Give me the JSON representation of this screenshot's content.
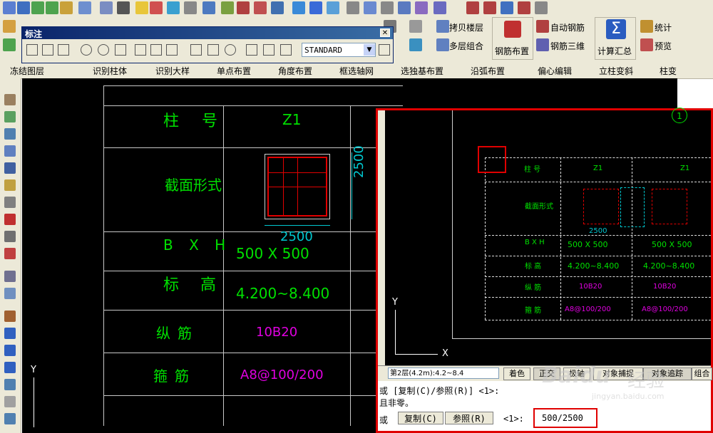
{
  "dialog": {
    "title": "标注",
    "style_value": "STANDARD"
  },
  "toolbar": {
    "copy_floor": "拷贝楼层",
    "multi_combine": "多层组合",
    "rebar_layout": "钢筋布置",
    "auto_rebar": "自动钢筋",
    "rebar_3d": "钢筋三维",
    "calc_summary": "计算汇总",
    "stats": "统计",
    "preview": "预览",
    "row3": [
      "冻结图层",
      "识别柱体",
      "识别大样",
      "单点布置",
      "角度布置",
      "框选轴网",
      "选独基布置",
      "沿弧布置",
      "偏心编辑",
      "立柱变斜",
      "柱变"
    ]
  },
  "table": {
    "col_header": "柱号",
    "col_id": "Z1",
    "row_section": "截面形式",
    "row_bxh": "B X H",
    "bxh_value": "500 X 500",
    "row_elev": "标高",
    "elev_value": "4.200~8.400",
    "row_long": "纵筋",
    "long_value": "10B20",
    "row_stirrup": "箍筋",
    "stirrup_value": "A8@100/200",
    "dim_horizontal": "2500",
    "dim_vertical": "2500",
    "axis_y": "Y"
  },
  "inset": {
    "circle_label": "1",
    "col_header": "柱 号",
    "col1": "Z1",
    "col2": "Z1",
    "row_section": "截面形式",
    "row_bxh": "B X H",
    "bxh1": "500 X 500",
    "bxh2": "500 X 500",
    "row_elev": "标 高",
    "elev1": "4.200~8.400",
    "elev2": "4.200~8.400",
    "row_long": "纵 筋",
    "long1": "10B20",
    "long2": "10B20",
    "row_stirrup": "箍 筋",
    "stirrup1": "A8@100/200",
    "stirrup2": "A8@100/200",
    "dim": "2500",
    "axis_x": "X",
    "axis_y": "Y",
    "floor_select": "第2层(4.2m):4.2~8.4",
    "status_buttons": [
      "着色",
      "正交",
      "极轴",
      "对象捕捉",
      "对象追踪",
      "组合"
    ],
    "cmd_line1": "或 [复制(C)/参照(R)] <1>:",
    "cmd_line2": "且非零。",
    "cmd_prefix": "或",
    "cmd_copy": "复制(C)",
    "cmd_ref": "参照(R)",
    "cmd_default": "<1>:",
    "cmd_input": "500/2500"
  },
  "watermark": {
    "brand": "Baidu",
    "cn": "经验",
    "url": "jingyan.baidu.com"
  },
  "colors": {
    "cad_bg": "#000000",
    "text_green": "#00e000",
    "text_magenta": "#e000e0",
    "dim_cyan": "#00c8d0",
    "highlight_red": "#e00000"
  }
}
